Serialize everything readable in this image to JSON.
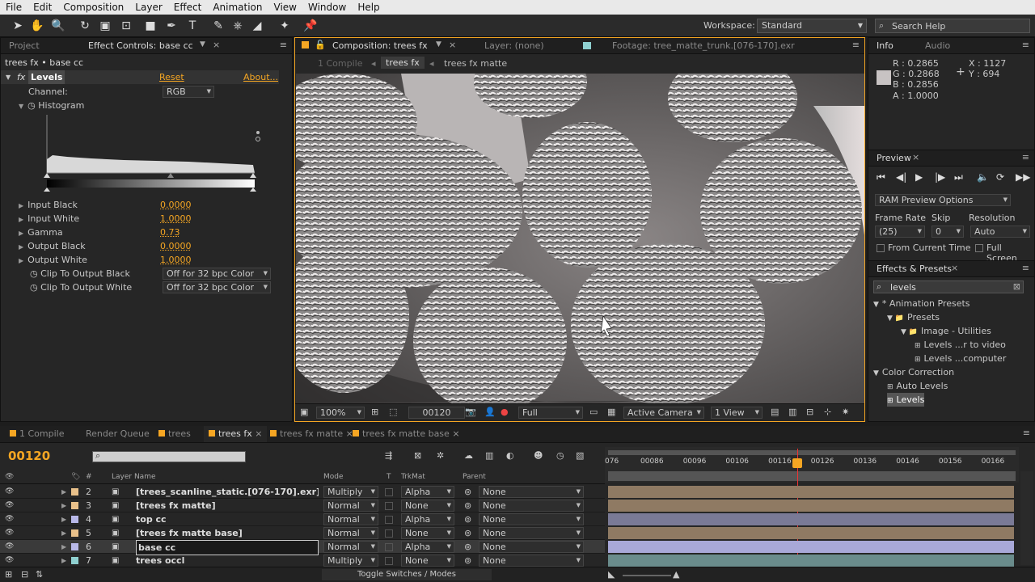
{
  "menu": [
    "File",
    "Edit",
    "Composition",
    "Layer",
    "Effect",
    "Animation",
    "View",
    "Window",
    "Help"
  ],
  "toolbar": {
    "workspace_label": "Workspace:",
    "workspace_value": "Standard",
    "search_placeholder": "Search Help"
  },
  "left_panel": {
    "tab_project": "Project",
    "tab_effect": "Effect Controls: base cc",
    "breadcrumb": "trees fx • base cc",
    "effect_name": "Levels",
    "reset": "Reset",
    "about": "About...",
    "channel_label": "Channel:",
    "channel_value": "RGB",
    "histogram_label": "Histogram",
    "props": [
      {
        "label": "Input Black",
        "value": "0.0000"
      },
      {
        "label": "Input White",
        "value": "1.0000"
      },
      {
        "label": "Gamma",
        "value": "0.73"
      },
      {
        "label": "Output Black",
        "value": "0.0000"
      },
      {
        "label": "Output White",
        "value": "1.0000"
      }
    ],
    "clips": [
      {
        "label": "Clip To Output Black",
        "value": "Off for 32 bpc Color"
      },
      {
        "label": "Clip To Output White",
        "value": "Off for 32 bpc Color"
      }
    ]
  },
  "viewer": {
    "tab_comp": "Composition: trees fx",
    "tab_layer": "Layer: (none)",
    "tab_footage": "Footage: tree_matte_trunk.[076-170].exr",
    "crumbs": [
      "1 Compile",
      "trees fx",
      "trees fx matte"
    ],
    "zoom": "100%",
    "timecode": "00120",
    "resolution": "Full",
    "camera": "Active Camera",
    "views": "1 View"
  },
  "info": {
    "tab_info": "Info",
    "tab_audio": "Audio",
    "r": "R : 0.2865",
    "g": "G : 0.2868",
    "b": "B : 0.2856",
    "a": "A : 1.0000",
    "x": "X : 1127",
    "y": "Y : 694"
  },
  "preview": {
    "title": "Preview",
    "ram": "RAM Preview Options",
    "frame_rate_label": "Frame Rate",
    "skip_label": "Skip",
    "resolution_label": "Resolution",
    "frame_rate": "(25)",
    "skip": "0",
    "resolution": "Auto",
    "from_current": "From Current Time",
    "full_screen": "Full Screen"
  },
  "effects": {
    "title": "Effects & Presets",
    "search": "levels",
    "tree": [
      {
        "label": "* Animation Presets",
        "indent": 0,
        "type": "open"
      },
      {
        "label": "Presets",
        "indent": 1,
        "type": "folder"
      },
      {
        "label": "Image - Utilities",
        "indent": 2,
        "type": "folder"
      },
      {
        "label": "Levels ...r to video",
        "indent": 3,
        "type": "fx"
      },
      {
        "label": "Levels ...computer",
        "indent": 3,
        "type": "fx"
      },
      {
        "label": "Color Correction",
        "indent": 0,
        "type": "open"
      },
      {
        "label": "Auto Levels",
        "indent": 1,
        "type": "fx"
      },
      {
        "label": "Levels",
        "indent": 1,
        "type": "fx",
        "selected": true
      }
    ]
  },
  "timeline": {
    "tabs": [
      "1 Compile",
      "Render Queue",
      "trees",
      "trees fx",
      "trees fx matte",
      "trees fx matte base"
    ],
    "active_tab": 3,
    "timecode": "00120",
    "headers": {
      "hash": "#",
      "name": "Layer Name",
      "mode": "Mode",
      "t": "T",
      "trkmat": "TrkMat",
      "parent": "Parent"
    },
    "ruler": [
      "076",
      "00086",
      "00096",
      "00106",
      "00116",
      "00126",
      "00136",
      "00146",
      "00156",
      "00166"
    ],
    "toggle": "Toggle Switches / Modes",
    "layers": [
      {
        "num": "2",
        "name": "[trees_scanline_static.[076-170].exr]",
        "mode": "Multiply",
        "trk": "Alpha",
        "parent": "None",
        "color": "#e8c08a",
        "bar": "#8f7a63"
      },
      {
        "num": "3",
        "name": "[trees fx matte]",
        "mode": "Normal",
        "trk": "None",
        "parent": "None",
        "color": "#e8c08a",
        "bar": "#8f7a63"
      },
      {
        "num": "4",
        "name": "top cc",
        "mode": "Normal",
        "trk": "Alpha",
        "parent": "None",
        "color": "#b8b8e8",
        "bar": "#7a7a96"
      },
      {
        "num": "5",
        "name": "[trees fx matte base]",
        "mode": "Normal",
        "trk": "None",
        "parent": "None",
        "color": "#e8c08a",
        "bar": "#8f7a63"
      },
      {
        "num": "6",
        "name": "base cc",
        "mode": "Normal",
        "trk": "Alpha",
        "parent": "None",
        "color": "#b8b8e8",
        "bar": "#a8a8d8",
        "selected": true
      },
      {
        "num": "7",
        "name": "trees occl",
        "mode": "Multiply",
        "trk": "None",
        "parent": "None",
        "color": "#8fd0d0",
        "bar": "#6a8c8c"
      }
    ]
  }
}
